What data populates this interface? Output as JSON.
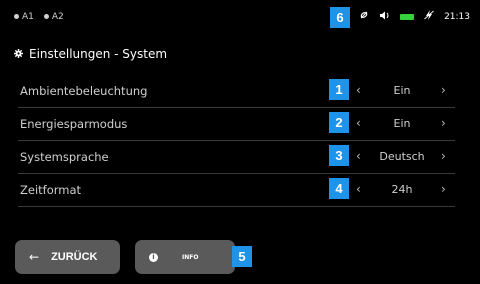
{
  "status": {
    "outputs": [
      "A1",
      "A2"
    ],
    "time": "21:13",
    "icons": [
      "satellite-icon",
      "speaker-icon",
      "battery-icon",
      "charging-icon"
    ]
  },
  "screen": {
    "title": "Einstellungen - System"
  },
  "settings": [
    {
      "badge": "1",
      "label": "Ambientebeleuchtung",
      "value": "Ein"
    },
    {
      "badge": "2",
      "label": "Energiesparmodus",
      "value": "Ein"
    },
    {
      "badge": "3",
      "label": "Systemsprache",
      "value": "Deutsch"
    },
    {
      "badge": "4",
      "label": "Zeitformat",
      "value": "24h"
    }
  ],
  "buttons": {
    "back_label": "ZURÜCK",
    "info_label": "INFO",
    "info_badge": "5"
  },
  "status_badge": "6",
  "colors": {
    "background": "#000000",
    "badge": "#1f93e8",
    "button": "#5a5a5a",
    "battery": "#37d23c"
  }
}
